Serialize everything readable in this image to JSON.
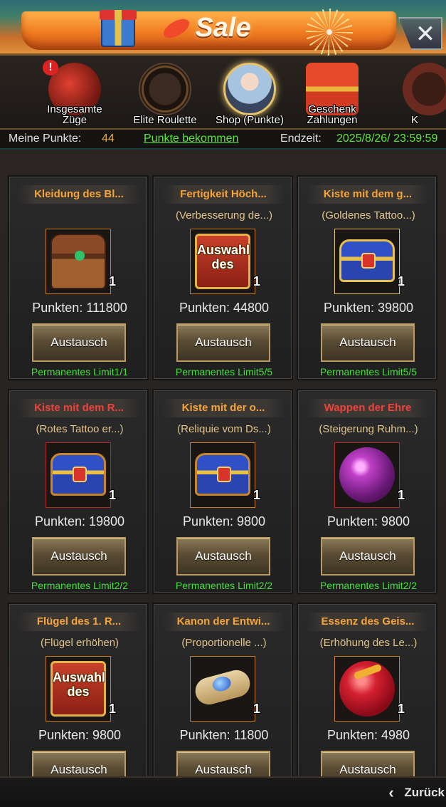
{
  "header": {
    "title": "Sale"
  },
  "tabs": [
    {
      "label": "Insgesamte Züge",
      "badge": "!"
    },
    {
      "label": "Elite Roulette"
    },
    {
      "label": "Shop (Punkte)"
    },
    {
      "label": "Geschenk Zahlungen"
    },
    {
      "label": "K"
    }
  ],
  "points": {
    "label": "Meine Punkte:",
    "value": "44",
    "link": "Punkte bekommen",
    "end_label": "Endzeit:",
    "end_value": "2025/8/26/ 23:59:59"
  },
  "items": [
    {
      "title": "Kleidung des Bl...",
      "sub": "",
      "qty": "1",
      "price": "Punkten: 111800",
      "button": "Austausch",
      "limit": "Permanentes Limit1/1"
    },
    {
      "title": "Fertigkeit Höch...",
      "sub": "(Verbesserung de...)",
      "qty": "1",
      "art_text": "Auswahl des",
      "price": "Punkten: 44800",
      "button": "Austausch",
      "limit": "Permanentes Limit5/5"
    },
    {
      "title": "Kiste mit dem g...",
      "sub": "(Goldenes Tattoo...)",
      "qty": "1",
      "price": "Punkten: 39800",
      "button": "Austausch",
      "limit": "Permanentes Limit5/5"
    },
    {
      "title": "Kiste mit dem R...",
      "sub": "(Rotes Tattoo er...)",
      "qty": "1",
      "price": "Punkten: 19800",
      "button": "Austausch",
      "limit": "Permanentes Limit2/2"
    },
    {
      "title": "Kiste mit der o...",
      "sub": "(Reliquie vom Ds...)",
      "qty": "1",
      "price": "Punkten: 9800",
      "button": "Austausch",
      "limit": "Permanentes Limit2/2"
    },
    {
      "title": "Wappen der Ehre",
      "sub": "(Steigerung Ruhm...)",
      "qty": "1",
      "price": "Punkten: 9800",
      "button": "Austausch",
      "limit": "Permanentes Limit2/2"
    },
    {
      "title": "Flügel des 1. R...",
      "sub": "(Flügel erhöhen)",
      "qty": "1",
      "art_text": "Auswahl des",
      "price": "Punkten: 9800",
      "button": "Austausch",
      "limit": ""
    },
    {
      "title": "Kanon der Entwi...",
      "sub": "(Proportionelle ...)",
      "qty": "1",
      "price": "Punkten: 11800",
      "button": "Austausch",
      "limit": ""
    },
    {
      "title": "Essenz des Geis...",
      "sub": "(Erhöhung des Le...)",
      "qty": "1",
      "price": "Punkten: 4980",
      "button": "Austausch",
      "limit": ""
    }
  ],
  "footer": {
    "back": "Zurück"
  },
  "colors": {
    "title_orange": "#f6a43a",
    "title_red": "#f2413a",
    "limit_green": "#43e03a",
    "link_green": "#5ce63a"
  }
}
